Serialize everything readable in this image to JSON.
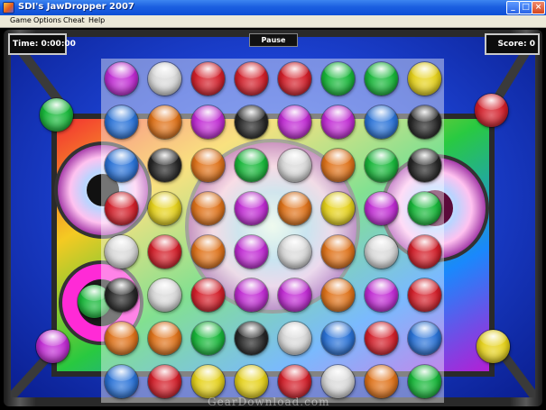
{
  "window": {
    "title": "SDI's JawDropper 2007",
    "controls": {
      "minimize": "_",
      "maximize": "□",
      "close": "×"
    }
  },
  "menu": {
    "game": "Game",
    "options": "Options",
    "cheat": "Cheat",
    "help": "Help"
  },
  "hud": {
    "time": "Time: 0:00:00",
    "pause": "Pause",
    "score": "Score: 0"
  },
  "colors": {
    "purple": "#c12bd4",
    "white": "#d9d9d9",
    "red": "#d41f2a",
    "green": "#18b83a",
    "yellow": "#e6d21a",
    "blue": "#2a73d8",
    "orange": "#e0731a",
    "black": "#262626"
  },
  "board": {
    "rows": [
      [
        "purple",
        "white",
        "red",
        "red",
        "red",
        "green",
        "green",
        "yellow"
      ],
      [
        "blue",
        "orange",
        "purple",
        "black",
        "purple",
        "purple",
        "blue",
        "black"
      ],
      [
        "blue",
        "black",
        "orange",
        "green",
        "white",
        "orange",
        "green",
        "black"
      ],
      [
        "red",
        "yellow",
        "orange",
        "purple",
        "orange",
        "yellow",
        "purple",
        "green"
      ],
      [
        "white",
        "red",
        "orange",
        "purple",
        "white",
        "orange",
        "white",
        "red"
      ],
      [
        "black",
        "white",
        "red",
        "purple",
        "purple",
        "orange",
        "purple",
        "red"
      ],
      [
        "orange",
        "orange",
        "green",
        "black",
        "white",
        "blue",
        "red",
        "blue"
      ],
      [
        "blue",
        "red",
        "yellow",
        "yellow",
        "red",
        "white",
        "orange",
        "green"
      ]
    ]
  },
  "corner_balls": {
    "top_left": "green",
    "top_right": "red",
    "bottom_left": "purple",
    "bottom_right": "yellow",
    "left_mid": "green"
  },
  "watermark": "GearDownload.com"
}
